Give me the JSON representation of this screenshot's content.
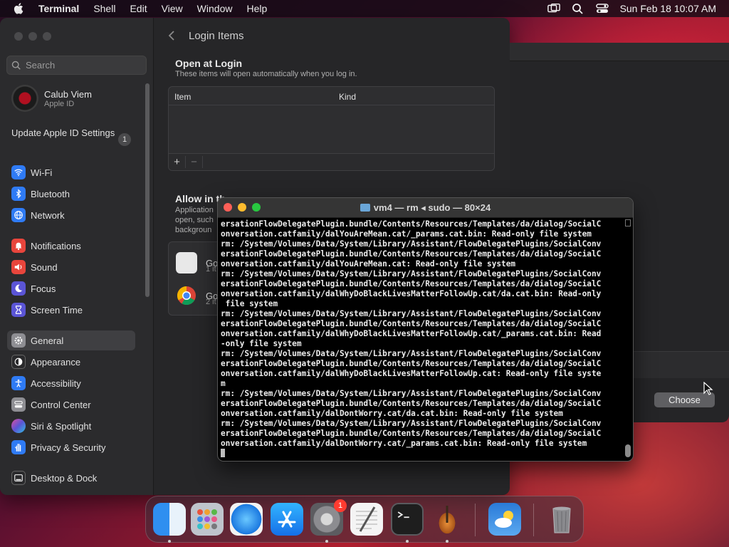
{
  "menubar": {
    "app": "Terminal",
    "items": [
      "Shell",
      "Edit",
      "View",
      "Window",
      "Help"
    ],
    "clock": "Sun Feb 18  10:07 AM"
  },
  "sidebar": {
    "search_placeholder": "Search",
    "account": {
      "name": "Calub Viem",
      "sub": "Apple ID"
    },
    "update": {
      "label": "Update Apple ID Settings",
      "badge": "1"
    },
    "items": [
      {
        "label": "Wi-Fi",
        "icon": "wifi-icon",
        "color": "#2f7bf5"
      },
      {
        "label": "Bluetooth",
        "icon": "bluetooth-icon",
        "color": "#2f7bf5"
      },
      {
        "label": "Network",
        "icon": "globe-icon",
        "color": "#2f7bf5"
      },
      {
        "label": "Notifications",
        "icon": "bell-icon",
        "color": "#e8453c"
      },
      {
        "label": "Sound",
        "icon": "speaker-icon",
        "color": "#e8453c"
      },
      {
        "label": "Focus",
        "icon": "moon-icon",
        "color": "#5b55d6"
      },
      {
        "label": "Screen Time",
        "icon": "hourglass-icon",
        "color": "#5b55d6"
      },
      {
        "label": "General",
        "icon": "gear-icon",
        "color": "#8e8e93"
      },
      {
        "label": "Appearance",
        "icon": "appearance-icon",
        "color": "#2a2a2c"
      },
      {
        "label": "Accessibility",
        "icon": "accessibility-icon",
        "color": "#2f7bf5"
      },
      {
        "label": "Control Center",
        "icon": "control-center-icon",
        "color": "#8e8e93"
      },
      {
        "label": "Siri & Spotlight",
        "icon": "siri-icon",
        "color": "#c04fd6"
      },
      {
        "label": "Privacy & Security",
        "icon": "hand-icon",
        "color": "#2f7bf5"
      },
      {
        "label": "Desktop & Dock",
        "icon": "dock-icon",
        "color": "#2a2a2c"
      }
    ]
  },
  "content": {
    "title": "Login Items",
    "open_at_login": "Open at Login",
    "open_sub": "These items will open automatically when you log in.",
    "col_item": "Item",
    "col_kind": "Kind",
    "add": "+",
    "remove": "−",
    "allow_title": "Allow in th",
    "allow_sub": "Application open, such backgroun",
    "bg_items": [
      {
        "name": "Go",
        "count": "1 it"
      },
      {
        "name": "Go",
        "count": "2 it"
      }
    ]
  },
  "dialog": {
    "choose": "Choose"
  },
  "terminal": {
    "title": "vm4 — rm ◂ sudo — 80×24",
    "lines": [
      "ersationFlowDelegatePlugin.bundle/Contents/Resources/Templates/da/dialog/SocialC",
      "onversation.catfamily/dalYouAreMean.cat/_params.cat.bin: Read-only file system",
      "rm: /System/Volumes/Data/System/Library/Assistant/FlowDelegatePlugins/SocialConv",
      "ersationFlowDelegatePlugin.bundle/Contents/Resources/Templates/da/dialog/SocialC",
      "onversation.catfamily/dalYouAreMean.cat: Read-only file system",
      "rm: /System/Volumes/Data/System/Library/Assistant/FlowDelegatePlugins/SocialConv",
      "ersationFlowDelegatePlugin.bundle/Contents/Resources/Templates/da/dialog/SocialC",
      "onversation.catfamily/dalWhyDoBlackLivesMatterFollowUp.cat/da.cat.bin: Read-only",
      " file system",
      "rm: /System/Volumes/Data/System/Library/Assistant/FlowDelegatePlugins/SocialConv",
      "ersationFlowDelegatePlugin.bundle/Contents/Resources/Templates/da/dialog/SocialC",
      "onversation.catfamily/dalWhyDoBlackLivesMatterFollowUp.cat/_params.cat.bin: Read",
      "-only file system",
      "rm: /System/Volumes/Data/System/Library/Assistant/FlowDelegatePlugins/SocialConv",
      "ersationFlowDelegatePlugin.bundle/Contents/Resources/Templates/da/dialog/SocialC",
      "onversation.catfamily/dalWhyDoBlackLivesMatterFollowUp.cat: Read-only file syste",
      "m",
      "rm: /System/Volumes/Data/System/Library/Assistant/FlowDelegatePlugins/SocialConv",
      "ersationFlowDelegatePlugin.bundle/Contents/Resources/Templates/da/dialog/SocialC",
      "onversation.catfamily/dalDontWorry.cat/da.cat.bin: Read-only file system",
      "rm: /System/Volumes/Data/System/Library/Assistant/FlowDelegatePlugins/SocialConv",
      "ersationFlowDelegatePlugin.bundle/Contents/Resources/Templates/da/dialog/SocialC",
      "onversation.catfamily/dalDontWorry.cat/_params.cat.bin: Read-only file system"
    ]
  },
  "dock": {
    "apps": [
      {
        "name": "finder-icon",
        "running": true
      },
      {
        "name": "launchpad-icon",
        "running": false
      },
      {
        "name": "safari-icon",
        "running": false
      },
      {
        "name": "app-store-icon",
        "running": false
      },
      {
        "name": "system-settings-icon",
        "running": true,
        "badge": "1"
      },
      {
        "name": "textedit-icon",
        "running": false
      },
      {
        "name": "terminal-icon",
        "running": true
      },
      {
        "name": "garageband-icon",
        "running": true
      },
      {
        "name": "weather-icon",
        "running": false
      },
      {
        "name": "trash-icon",
        "running": false
      }
    ]
  }
}
